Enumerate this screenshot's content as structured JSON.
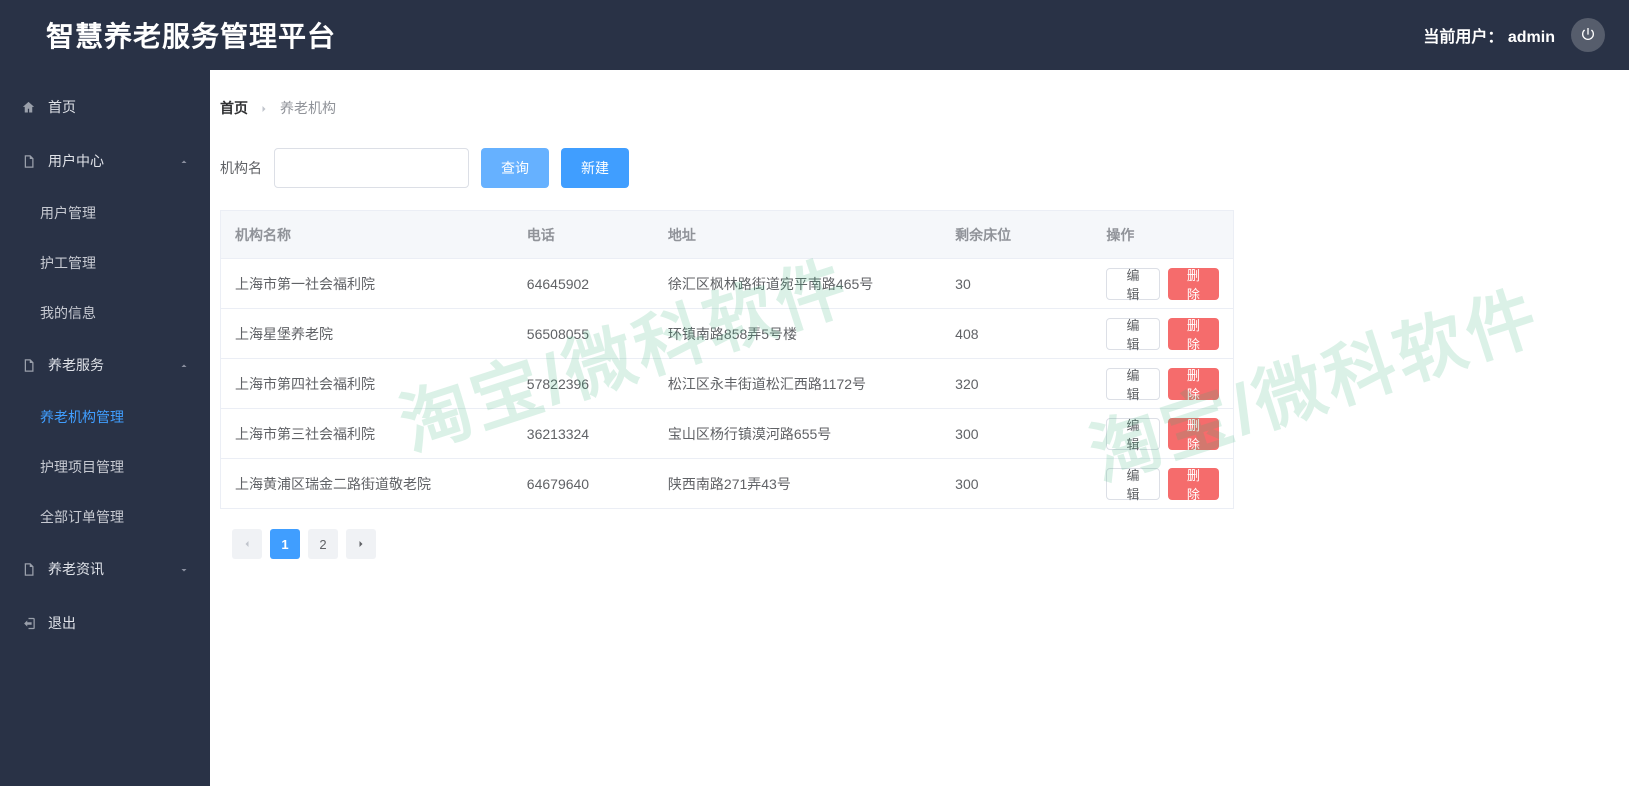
{
  "header": {
    "title": "智慧养老服务管理平台",
    "user_prefix": "当前用户：",
    "user_name": "admin"
  },
  "sidebar": {
    "items": [
      {
        "label": "首页",
        "icon": "home",
        "type": "item"
      },
      {
        "label": "用户中心",
        "icon": "doc",
        "type": "submenu",
        "open": true,
        "children": [
          {
            "label": "用户管理"
          },
          {
            "label": "护工管理"
          },
          {
            "label": "我的信息"
          }
        ]
      },
      {
        "label": "养老服务",
        "icon": "doc",
        "type": "submenu",
        "open": true,
        "children": [
          {
            "label": "养老机构管理",
            "active": true
          },
          {
            "label": "护理项目管理"
          },
          {
            "label": "全部订单管理"
          }
        ]
      },
      {
        "label": "养老资讯",
        "icon": "doc",
        "type": "submenu",
        "open": false
      },
      {
        "label": "退出",
        "icon": "logout",
        "type": "item"
      }
    ]
  },
  "breadcrumb": {
    "items": [
      "首页",
      "养老机构"
    ]
  },
  "toolbar": {
    "search_label": "机构名",
    "search_value": "",
    "query_btn": "查询",
    "new_btn": "新建"
  },
  "table": {
    "headers": [
      "机构名称",
      "电话",
      "地址",
      "剩余床位",
      "操作"
    ],
    "action_edit": "编辑",
    "action_delete": "删除",
    "rows": [
      {
        "name": "上海市第一社会福利院",
        "phone": "64645902",
        "addr": "徐汇区枫林路街道宛平南路465号",
        "beds": "30"
      },
      {
        "name": "上海星堡养老院",
        "phone": "56508055",
        "addr": "环镇南路858弄5号楼",
        "beds": "408"
      },
      {
        "name": "上海市第四社会福利院",
        "phone": "57822396",
        "addr": "松江区永丰街道松汇西路1172号",
        "beds": "320"
      },
      {
        "name": "上海市第三社会福利院",
        "phone": "36213324",
        "addr": "宝山区杨行镇漠河路655号",
        "beds": "300"
      },
      {
        "name": "上海黄浦区瑞金二路街道敬老院",
        "phone": "64679640",
        "addr": "陕西南路271弄43号",
        "beds": "300"
      }
    ]
  },
  "pagination": {
    "pages": [
      "1",
      "2"
    ],
    "active": "1"
  },
  "watermark": "淘宝/微科软件"
}
